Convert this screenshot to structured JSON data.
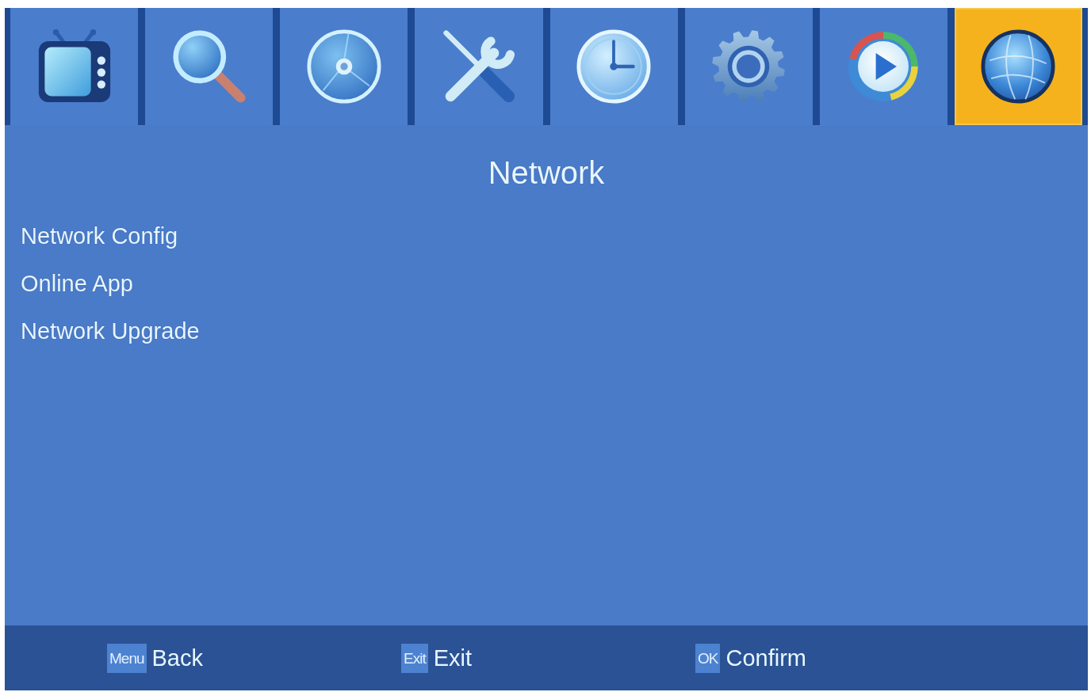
{
  "tabs": [
    {
      "kind": "tv",
      "selected": false
    },
    {
      "kind": "search",
      "selected": false
    },
    {
      "kind": "disc",
      "selected": false
    },
    {
      "kind": "tools",
      "selected": false
    },
    {
      "kind": "clock",
      "selected": false
    },
    {
      "kind": "gear",
      "selected": false
    },
    {
      "kind": "media",
      "selected": false
    },
    {
      "kind": "globe",
      "selected": true
    }
  ],
  "title": "Network",
  "menu": {
    "items": [
      "Network Config",
      "Online App",
      "Network Upgrade"
    ]
  },
  "footer": {
    "hints": [
      {
        "key": "Menu",
        "label": "Back"
      },
      {
        "key": "Exit",
        "label": "Exit"
      },
      {
        "key": "OK",
        "label": "Confirm"
      }
    ]
  }
}
